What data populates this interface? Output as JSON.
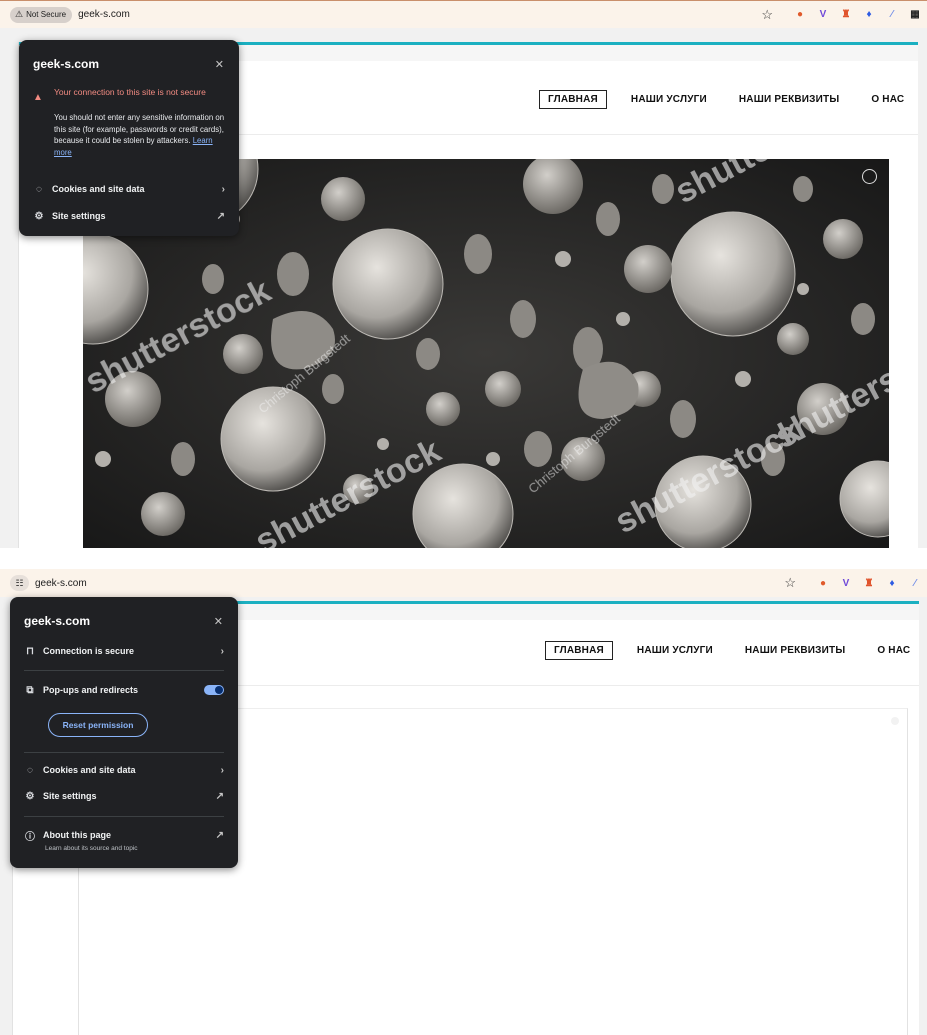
{
  "browser": {
    "not_secure_label": "Not Secure",
    "url": "geek-s.com"
  },
  "colors": {
    "accent_teal": "#1bb0c1",
    "popup_bg": "#202124",
    "warning_red": "#f28b82",
    "link_blue": "#8ab4f8"
  },
  "site": {
    "nav": [
      "ГЛАВНАЯ",
      "НАШИ УСЛУГИ",
      "НАШИ РЕКВИЗИТЫ",
      "О НАС"
    ]
  },
  "popup_insecure": {
    "title": "geek-s.com",
    "warning_title": "Your connection to this site is not secure",
    "warning_body": "You should not enter any sensitive information on this site (for example, passwords or credit cards), because it could be stolen by attackers.",
    "learn_more": "Learn more",
    "cookies_label": "Cookies and site data",
    "site_settings_label": "Site settings"
  },
  "popup_secure": {
    "title": "geek-s.com",
    "connection_label": "Connection is secure",
    "popups_label": "Pop-ups and redirects",
    "popups_enabled": true,
    "reset_label": "Reset permission",
    "cookies_label": "Cookies and site data",
    "site_settings_label": "Site settings",
    "about_label": "About this page",
    "about_sub": "Learn about its source and topic"
  },
  "hero_image": {
    "watermark_a": "shutterstock",
    "watermark_b": "Christoph Burgstedt"
  }
}
